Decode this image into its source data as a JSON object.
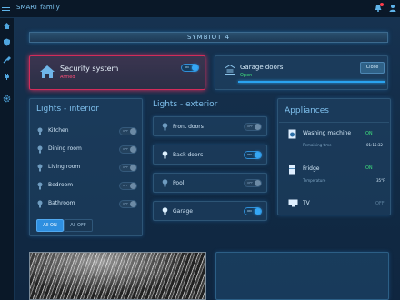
{
  "app": {
    "title": "SMART family"
  },
  "brand": {
    "name": "SYMBIOT 4"
  },
  "security": {
    "label": "Security system",
    "status": "Armed",
    "toggle_text": "ON"
  },
  "garage_doors": {
    "label": "Garage doors",
    "status": "Open",
    "button": "Close"
  },
  "lights_interior": {
    "title": "Lights - interior",
    "items": [
      {
        "label": "Kitchen",
        "toggle": "OFF"
      },
      {
        "label": "Dining room",
        "toggle": "OFF"
      },
      {
        "label": "Living room",
        "toggle": "OFF"
      },
      {
        "label": "Bedroom",
        "toggle": "OFF"
      },
      {
        "label": "Bathroom",
        "toggle": "OFF"
      }
    ],
    "all_on": "All ON",
    "all_off": "All OFF"
  },
  "lights_exterior": {
    "title": "Lights - exterior",
    "items": [
      {
        "label": "Front doors",
        "toggle": "OFF",
        "on": false
      },
      {
        "label": "Back doors",
        "toggle": "ON",
        "on": true
      },
      {
        "label": "Pool",
        "toggle": "OFF",
        "on": false
      },
      {
        "label": "Garage",
        "toggle": "ON",
        "on": true
      }
    ]
  },
  "appliances": {
    "title": "Appliances",
    "items": [
      {
        "label": "Washing machine",
        "status": "ON",
        "key": "Remaining time",
        "value": "01:15:32"
      },
      {
        "label": "Fridge",
        "status": "ON",
        "key": "Temperature",
        "value": "35°F"
      },
      {
        "label": "TV",
        "status": "OFF"
      }
    ]
  },
  "colors": {
    "accent": "#2aa3ef",
    "alert": "#e2315e",
    "ok": "#3fe07d"
  }
}
